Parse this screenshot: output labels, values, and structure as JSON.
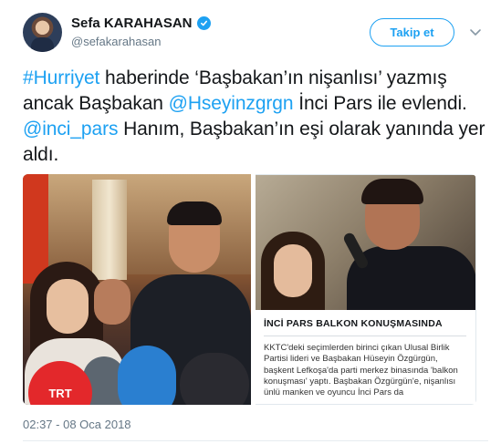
{
  "header": {
    "display_name": "Sefa KARAHASAN",
    "handle": "@sefakarahasan",
    "verified_icon": "verified-badge-icon",
    "follow_label": "Takip et",
    "menu_icon": "chevron-down-icon"
  },
  "tweet": {
    "segments": [
      {
        "text": "#Hurriyet",
        "link": true
      },
      {
        "text": " haberinde ‘Başbakan’ın nişanlısı’ yazmış ancak Başbakan ",
        "link": false
      },
      {
        "text": "@Hseyinzgrgn",
        "link": true
      },
      {
        "text": " İnci Pars ile evlendi. ",
        "link": false
      },
      {
        "text": "@inci_pars",
        "link": true
      },
      {
        "text": " Hanım, Başbakan’ın eşi olarak yanında yer aldı.",
        "link": false
      }
    ]
  },
  "media": {
    "left_photo_mic_label": "TRT",
    "caption_title": "İNCİ PARS BALKON KONUŞMASINDA",
    "caption_body": "KKTC'deki seçimlerden birinci çıkan Ulusal Birlik Partisi lideri ve Başbakan Hüseyin Özgürgün, başkent Lefkoşa'da parti merkez binasında 'balkon konuşması' yaptı. Başbakan Özgürgün'e, nişanlısı ünlü manken ve oyuncu İnci Pars da"
  },
  "footer": {
    "timestamp": "02:37 - 08 Oca 2018"
  },
  "colors": {
    "accent": "#1da1f2",
    "text": "#14171a",
    "muted": "#657786"
  }
}
